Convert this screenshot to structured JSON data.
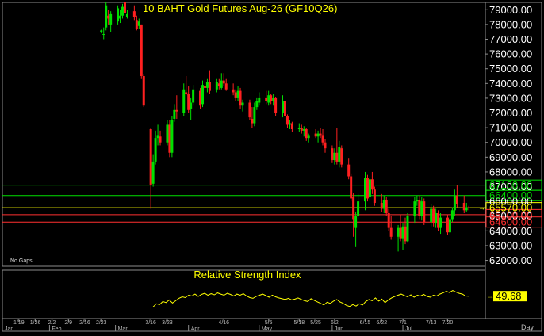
{
  "chart_data": {
    "type": "candlestick",
    "title": "10 BAHT  Gold  Futures  Aug-26  (GF10Q26)",
    "y_axis": {
      "position": "right",
      "range": [
        61600,
        79500
      ],
      "ticks": [
        "62000.00",
        "63000.00",
        "64000.00",
        "65000.00",
        "66000.00",
        "67000.00",
        "68000.00",
        "69000.00",
        "70000.00",
        "71000.00",
        "72000.00",
        "73000.00",
        "74000.00",
        "75000.00",
        "76000.00",
        "77000.00",
        "78000.00",
        "79000.00"
      ],
      "tick_values": [
        62000,
        63000,
        64000,
        65000,
        66000,
        67000,
        68000,
        69000,
        70000,
        71000,
        72000,
        73000,
        74000,
        75000,
        76000,
        77000,
        78000,
        79000
      ]
    },
    "price_levels": [
      {
        "label": "67100.00",
        "value": 67100,
        "color": "#00e000",
        "label_text_color": "#00d800"
      },
      {
        "label": "66400.00",
        "value": 66400,
        "color": "#00e000",
        "label_text_color": "#00d800"
      },
      {
        "label": "65570.00",
        "value": 65570,
        "color": "#ffff00",
        "label_text_color": "#ffff00"
      },
      {
        "label": "65100.00",
        "value": 65100,
        "color": "#ff3030",
        "label_text_color": "#ff3030"
      },
      {
        "label": "64600.00",
        "value": 64600,
        "color": "#ff3030",
        "label_text_color": "#ff3030"
      }
    ],
    "note_bottom_left": "No Gaps",
    "x_tick_labels": [
      "1/19",
      "1/26",
      "2/2",
      "2/9",
      "2/16",
      "2/23",
      "3/16",
      "3/23",
      "4/16",
      "5/5",
      "5/18",
      "5/25",
      "6/2",
      "6/15",
      "6/22",
      "7/1",
      "7/13",
      "7/20"
    ],
    "x_tick_dates": [
      "2026-01-19",
      "2026-01-26",
      "2026-02-02",
      "2026-02-09",
      "2026-02-16",
      "2026-02-23",
      "2026-03-16",
      "2026-03-23",
      "2026-04-16",
      "2026-05-05",
      "2026-05-18",
      "2026-05-25",
      "2026-06-02",
      "2026-06-15",
      "2026-06-22",
      "2026-07-01",
      "2026-07-13",
      "2026-07-20"
    ],
    "x_range_dates": [
      "2026-01-12",
      "2026-08-05"
    ],
    "month_labels": [
      "Jan",
      "Feb",
      "Mar",
      "Apr",
      "May",
      "Jun",
      "Jul"
    ],
    "month_dates": [
      "2026-01-12",
      "2026-02-01",
      "2026-03-01",
      "2026-04-01",
      "2026-05-01",
      "2026-06-01",
      "2026-07-01"
    ],
    "period_label": "Day",
    "colors": {
      "up": "#00e000",
      "down": "#ff2020",
      "doji": "#ffff00"
    },
    "candles": [
      {
        "d": "2026-02-23",
        "o": 77500,
        "h": 77650,
        "l": 77400,
        "c": 77600
      },
      {
        "d": "2026-02-24",
        "o": 77300,
        "h": 77800,
        "l": 77000,
        "c": 77350
      },
      {
        "d": "2026-02-25",
        "o": 77800,
        "h": 79500,
        "l": 77600,
        "c": 79300
      },
      {
        "d": "2026-02-26",
        "o": 78600,
        "h": 79000,
        "l": 78000,
        "c": 78400
      },
      {
        "d": "2026-02-27",
        "o": 78000,
        "h": 78900,
        "l": 77500,
        "c": 78700
      },
      {
        "d": "2026-03-02",
        "o": 78200,
        "h": 79300,
        "l": 78000,
        "c": 79100
      },
      {
        "d": "2026-03-03",
        "o": 78400,
        "h": 79000,
        "l": 78100,
        "c": 78600
      },
      {
        "d": "2026-03-04",
        "o": 78600,
        "h": 79400,
        "l": 78400,
        "c": 79200
      },
      {
        "d": "2026-03-05",
        "o": 79500,
        "h": 79500,
        "l": 78700,
        "c": 78800
      },
      {
        "d": "2026-03-06",
        "o": 78500,
        "h": 79000,
        "l": 78400,
        "c": 78700
      },
      {
        "d": "2026-03-09",
        "o": 78900,
        "h": 79300,
        "l": 78300,
        "c": 78500
      },
      {
        "d": "2026-03-10",
        "o": 78300,
        "h": 78600,
        "l": 77600,
        "c": 77700
      },
      {
        "d": "2026-03-11",
        "o": 77900,
        "h": 78400,
        "l": 77700,
        "c": 78200
      },
      {
        "d": "2026-03-12",
        "o": 78000,
        "h": 78000,
        "l": 74300,
        "c": 74500
      },
      {
        "d": "2026-03-13",
        "o": 74500,
        "h": 74600,
        "l": 72400,
        "c": 72500
      },
      {
        "d": "2026-03-16",
        "o": 70900,
        "h": 71000,
        "l": 65500,
        "c": 67100
      },
      {
        "d": "2026-03-17",
        "o": 67200,
        "h": 69200,
        "l": 67000,
        "c": 68700
      },
      {
        "d": "2026-03-18",
        "o": 68700,
        "h": 70800,
        "l": 68500,
        "c": 70300
      },
      {
        "d": "2026-03-19",
        "o": 70300,
        "h": 71200,
        "l": 69800,
        "c": 70500
      },
      {
        "d": "2026-03-20",
        "o": 70400,
        "h": 70800,
        "l": 69800,
        "c": 70000
      },
      {
        "d": "2026-03-23",
        "o": 70000,
        "h": 71500,
        "l": 69800,
        "c": 71200
      },
      {
        "d": "2026-03-24",
        "o": 71200,
        "h": 71500,
        "l": 69000,
        "c": 69300
      },
      {
        "d": "2026-03-25",
        "o": 69300,
        "h": 71800,
        "l": 69000,
        "c": 71500
      },
      {
        "d": "2026-03-26",
        "o": 71600,
        "h": 72600,
        "l": 71400,
        "c": 72200
      },
      {
        "d": "2026-03-27",
        "o": 72200,
        "h": 73200,
        "l": 71600,
        "c": 72100
      },
      {
        "d": "2026-03-30",
        "o": 72000,
        "h": 74000,
        "l": 71800,
        "c": 73600
      },
      {
        "d": "2026-03-31",
        "o": 73400,
        "h": 74500,
        "l": 73200,
        "c": 73300
      },
      {
        "d": "2026-04-01",
        "o": 73300,
        "h": 73800,
        "l": 72000,
        "c": 72200
      },
      {
        "d": "2026-04-02",
        "o": 72300,
        "h": 73000,
        "l": 71500,
        "c": 72700
      },
      {
        "d": "2026-04-03",
        "o": 72700,
        "h": 73900,
        "l": 72500,
        "c": 73600
      },
      {
        "d": "2026-04-06",
        "o": 73500,
        "h": 73700,
        "l": 72300,
        "c": 72500
      },
      {
        "d": "2026-04-07",
        "o": 72600,
        "h": 74200,
        "l": 72400,
        "c": 73900
      },
      {
        "d": "2026-04-08",
        "o": 73800,
        "h": 74600,
        "l": 73500,
        "c": 73700
      },
      {
        "d": "2026-04-09",
        "o": 73700,
        "h": 74300,
        "l": 73400,
        "c": 74100
      },
      {
        "d": "2026-04-10",
        "o": 74100,
        "h": 74900,
        "l": 73300,
        "c": 73500
      },
      {
        "d": "2026-04-13",
        "o": 73600,
        "h": 74300,
        "l": 73400,
        "c": 74100
      },
      {
        "d": "2026-04-14",
        "o": 74000,
        "h": 74300,
        "l": 73600,
        "c": 73800
      },
      {
        "d": "2026-04-15",
        "o": 73700,
        "h": 74700,
        "l": 73600,
        "c": 74200
      },
      {
        "d": "2026-04-16",
        "o": 74200,
        "h": 74700,
        "l": 73800,
        "c": 74000
      },
      {
        "d": "2026-04-17",
        "o": 74000,
        "h": 74300,
        "l": 73500,
        "c": 73600
      },
      {
        "d": "2026-04-20",
        "o": 73600,
        "h": 74000,
        "l": 73200,
        "c": 73400
      },
      {
        "d": "2026-04-21",
        "o": 73400,
        "h": 73600,
        "l": 72800,
        "c": 73000
      },
      {
        "d": "2026-04-22",
        "o": 73000,
        "h": 73800,
        "l": 72800,
        "c": 73500
      },
      {
        "d": "2026-04-23",
        "o": 73500,
        "h": 73700,
        "l": 72300,
        "c": 72500
      },
      {
        "d": "2026-04-24",
        "o": 72500,
        "h": 72900,
        "l": 72100,
        "c": 72700
      },
      {
        "d": "2026-04-27",
        "o": 72700,
        "h": 72900,
        "l": 71500,
        "c": 71700
      },
      {
        "d": "2026-04-28",
        "o": 71600,
        "h": 72400,
        "l": 71000,
        "c": 71300
      },
      {
        "d": "2026-04-29",
        "o": 71300,
        "h": 72700,
        "l": 71100,
        "c": 72400
      },
      {
        "d": "2026-04-30",
        "o": 72400,
        "h": 73000,
        "l": 72200,
        "c": 72800
      },
      {
        "d": "2026-05-01",
        "o": 72700,
        "h": 73400,
        "l": 72500,
        "c": 73000
      },
      {
        "d": "2026-05-04",
        "o": 73000,
        "h": 73500,
        "l": 72600,
        "c": 72800
      },
      {
        "d": "2026-05-05",
        "o": 72700,
        "h": 73500,
        "l": 72500,
        "c": 73200
      },
      {
        "d": "2026-05-06",
        "o": 73200,
        "h": 73300,
        "l": 72600,
        "c": 72800
      },
      {
        "d": "2026-05-07",
        "o": 72800,
        "h": 73300,
        "l": 72500,
        "c": 73000
      },
      {
        "d": "2026-05-08",
        "o": 73000,
        "h": 73100,
        "l": 71800,
        "c": 72000
      },
      {
        "d": "2026-05-11",
        "o": 72000,
        "h": 73200,
        "l": 71700,
        "c": 72800
      },
      {
        "d": "2026-05-12",
        "o": 72800,
        "h": 73200,
        "l": 71600,
        "c": 71800
      },
      {
        "d": "2026-05-13",
        "o": 71800,
        "h": 71900,
        "l": 71000,
        "c": 71200
      },
      {
        "d": "2026-05-14",
        "o": 71200,
        "h": 71500,
        "l": 70900,
        "c": 71300
      },
      {
        "d": "2026-05-15",
        "o": 71300,
        "h": 71400,
        "l": 70700,
        "c": 70900
      },
      {
        "d": "2026-05-18",
        "o": 70900,
        "h": 71300,
        "l": 70700,
        "c": 71000
      },
      {
        "d": "2026-05-19",
        "o": 71000,
        "h": 71200,
        "l": 70600,
        "c": 70800
      },
      {
        "d": "2026-05-20",
        "o": 70800,
        "h": 71100,
        "l": 70400,
        "c": 70900
      },
      {
        "d": "2026-05-21",
        "o": 70900,
        "h": 71000,
        "l": 70100,
        "c": 70300
      },
      {
        "d": "2026-05-22",
        "o": 70300,
        "h": 70600,
        "l": 70000,
        "c": 70500
      },
      {
        "d": "2026-05-25",
        "o": 70600,
        "h": 70900,
        "l": 70300,
        "c": 70400
      },
      {
        "d": "2026-05-26",
        "o": 70400,
        "h": 70800,
        "l": 70000,
        "c": 70600
      },
      {
        "d": "2026-05-27",
        "o": 70600,
        "h": 71000,
        "l": 70300,
        "c": 70500
      },
      {
        "d": "2026-05-28",
        "o": 70500,
        "h": 70900,
        "l": 69800,
        "c": 70000
      },
      {
        "d": "2026-05-29",
        "o": 70000,
        "h": 70200,
        "l": 69300,
        "c": 69600
      },
      {
        "d": "2026-06-01",
        "o": 69600,
        "h": 69800,
        "l": 68600,
        "c": 68800
      },
      {
        "d": "2026-06-02",
        "o": 68800,
        "h": 69600,
        "l": 68500,
        "c": 69300
      },
      {
        "d": "2026-06-03",
        "o": 69300,
        "h": 71000,
        "l": 68500,
        "c": 68700
      },
      {
        "d": "2026-06-04",
        "o": 68700,
        "h": 70100,
        "l": 68300,
        "c": 69700
      },
      {
        "d": "2026-06-05",
        "o": 69600,
        "h": 69800,
        "l": 68300,
        "c": 68500
      },
      {
        "d": "2026-06-08",
        "o": 68500,
        "h": 68900,
        "l": 67500,
        "c": 67700
      },
      {
        "d": "2026-06-09",
        "o": 67700,
        "h": 67900,
        "l": 66000,
        "c": 66200
      },
      {
        "d": "2026-06-10",
        "o": 66300,
        "h": 66600,
        "l": 63600,
        "c": 64800
      },
      {
        "d": "2026-06-11",
        "o": 64200,
        "h": 65300,
        "l": 62900,
        "c": 65000
      },
      {
        "d": "2026-06-12",
        "o": 65000,
        "h": 66500,
        "l": 64800,
        "c": 66000
      },
      {
        "d": "2026-06-15",
        "o": 66000,
        "h": 68000,
        "l": 65400,
        "c": 67600
      },
      {
        "d": "2026-06-16",
        "o": 67600,
        "h": 67800,
        "l": 66000,
        "c": 66200
      },
      {
        "d": "2026-06-17",
        "o": 66300,
        "h": 67700,
        "l": 66000,
        "c": 67500
      },
      {
        "d": "2026-06-18",
        "o": 67500,
        "h": 68000,
        "l": 66500,
        "c": 66800
      },
      {
        "d": "2026-06-19",
        "o": 66800,
        "h": 67000,
        "l": 65700,
        "c": 65900
      },
      {
        "d": "2026-06-22",
        "o": 65900,
        "h": 66500,
        "l": 65300,
        "c": 65500
      },
      {
        "d": "2026-06-23",
        "o": 65500,
        "h": 66400,
        "l": 65200,
        "c": 66100
      },
      {
        "d": "2026-06-24",
        "o": 66100,
        "h": 66300,
        "l": 65000,
        "c": 65200
      },
      {
        "d": "2026-06-25",
        "o": 65200,
        "h": 65500,
        "l": 64000,
        "c": 64200
      },
      {
        "d": "2026-06-26",
        "o": 64200,
        "h": 65000,
        "l": 63400,
        "c": 63600
      },
      {
        "d": "2026-06-29",
        "o": 63600,
        "h": 64400,
        "l": 62600,
        "c": 64200
      },
      {
        "d": "2026-06-30",
        "o": 64200,
        "h": 65100,
        "l": 63300,
        "c": 63500
      },
      {
        "d": "2026-07-01",
        "o": 63500,
        "h": 64500,
        "l": 62700,
        "c": 64300
      },
      {
        "d": "2026-07-02",
        "o": 64300,
        "h": 64900,
        "l": 63100,
        "c": 63300
      },
      {
        "d": "2026-07-03",
        "o": 63300,
        "h": 65200,
        "l": 63200,
        "c": 65000
      },
      {
        "d": "2026-07-06",
        "o": 65000,
        "h": 66300,
        "l": 64500,
        "c": 66000
      },
      {
        "d": "2026-07-07",
        "o": 66000,
        "h": 66400,
        "l": 65700,
        "c": 66100
      },
      {
        "d": "2026-07-08",
        "o": 66100,
        "h": 66400,
        "l": 64800,
        "c": 65000
      },
      {
        "d": "2026-07-09",
        "o": 65000,
        "h": 66300,
        "l": 64700,
        "c": 66000
      },
      {
        "d": "2026-07-10",
        "o": 66000,
        "h": 66200,
        "l": 64400,
        "c": 64600
      },
      {
        "d": "2026-07-13",
        "o": 64600,
        "h": 65800,
        "l": 64300,
        "c": 65500
      },
      {
        "d": "2026-07-14",
        "o": 65500,
        "h": 65700,
        "l": 64300,
        "c": 64500
      },
      {
        "d": "2026-07-15",
        "o": 64500,
        "h": 65500,
        "l": 64200,
        "c": 65200
      },
      {
        "d": "2026-07-16",
        "o": 65200,
        "h": 65400,
        "l": 64000,
        "c": 64200
      },
      {
        "d": "2026-07-17",
        "o": 64200,
        "h": 65200,
        "l": 63800,
        "c": 64900
      },
      {
        "d": "2026-07-20",
        "o": 64900,
        "h": 65100,
        "l": 63700,
        "c": 63900
      },
      {
        "d": "2026-07-21",
        "o": 63900,
        "h": 65000,
        "l": 63700,
        "c": 64800
      },
      {
        "d": "2026-07-22",
        "o": 64800,
        "h": 65600,
        "l": 64600,
        "c": 65400
      },
      {
        "d": "2026-07-23",
        "o": 65400,
        "h": 66800,
        "l": 65000,
        "c": 66400
      },
      {
        "d": "2026-07-24",
        "o": 66400,
        "h": 67100,
        "l": 65600,
        "c": 65800
      },
      {
        "d": "2026-07-27",
        "o": 65900,
        "h": 66400,
        "l": 65200,
        "c": 65400
      },
      {
        "d": "2026-07-28",
        "o": 65400,
        "h": 65900,
        "l": 65300,
        "c": 65600
      },
      {
        "d": "2026-07-29",
        "o": 65600,
        "h": 65700,
        "l": 65400,
        "c": 65570
      }
    ],
    "rsi": {
      "title": "Relative Strength Index",
      "last_label": "49.68",
      "range": [
        0,
        100
      ],
      "color": "#ffff00",
      "start_date": "2026-03-17",
      "values": [
        22,
        30,
        28,
        36,
        33,
        40,
        32,
        38,
        44,
        48,
        46,
        52,
        50,
        55,
        49,
        54,
        57,
        52,
        56,
        53,
        58,
        55,
        52,
        57,
        54,
        50,
        55,
        52,
        56,
        50,
        46,
        44,
        49,
        52,
        55,
        51,
        47,
        52,
        48,
        45,
        43,
        41,
        44,
        40,
        42,
        45,
        41,
        38,
        36,
        43,
        39,
        35,
        31,
        27,
        34,
        31,
        37,
        41,
        35,
        31,
        26,
        23,
        28,
        24,
        30,
        27,
        36,
        41,
        38,
        45,
        37,
        42,
        33,
        40,
        45,
        49,
        52,
        55,
        51,
        48,
        53,
        47,
        52,
        50,
        54,
        49,
        47,
        52,
        50,
        55,
        58,
        62,
        59,
        64,
        60,
        57,
        55,
        50,
        49.68
      ]
    }
  }
}
